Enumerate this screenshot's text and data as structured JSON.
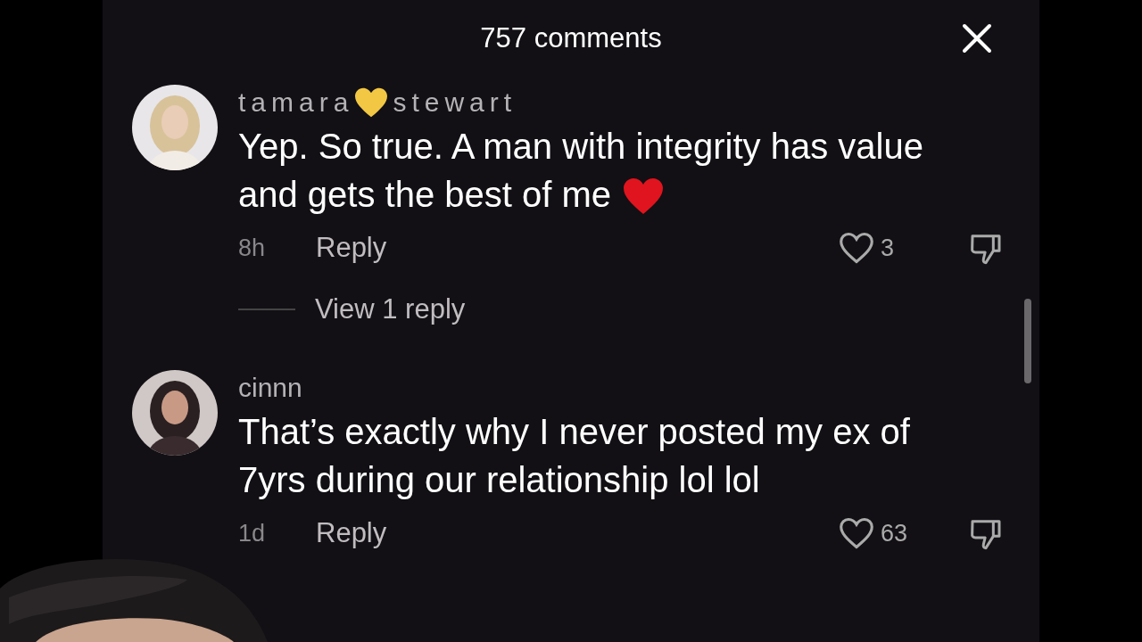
{
  "header": {
    "title": "757 comments"
  },
  "comments": [
    {
      "username": [
        "tamara",
        "stewart"
      ],
      "text": "Yep. So true. A man with integrity has value and gets the best of me",
      "trailing_heart": true,
      "time": "8h",
      "reply": "Reply",
      "likes": "3",
      "view_replies": "View 1 reply"
    },
    {
      "username": [
        "cinnn"
      ],
      "text": "That’s exactly why I never posted my ex of 7yrs during our relationship lol lol",
      "trailing_heart": false,
      "time": "1d",
      "reply": "Reply",
      "likes": "63"
    }
  ]
}
